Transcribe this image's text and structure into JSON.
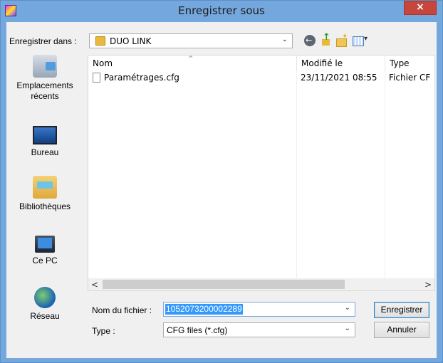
{
  "window": {
    "title": "Enregistrer sous",
    "close_glyph": "×"
  },
  "location": {
    "label": "Enregistrer dans :",
    "value": "DUO LINK"
  },
  "places": [
    {
      "label": "Emplacements récents",
      "icon": "recent-places-icon"
    },
    {
      "label": "Bureau",
      "icon": "desktop-icon"
    },
    {
      "label": "Bibliothèques",
      "icon": "libraries-icon"
    },
    {
      "label": "Ce PC",
      "icon": "this-pc-icon"
    },
    {
      "label": "Réseau",
      "icon": "network-icon"
    }
  ],
  "columns": {
    "name": "Nom",
    "modified": "Modifié le",
    "type": "Type"
  },
  "files": [
    {
      "name": "Paramétrages.cfg",
      "modified": "23/11/2021 08:55",
      "type": "Fichier CF"
    }
  ],
  "filename": {
    "label": "Nom du fichier :",
    "value": "1052073200002289"
  },
  "filetype": {
    "label": "Type :",
    "value": "CFG files (*.cfg)"
  },
  "buttons": {
    "save": "Enregistrer",
    "cancel": "Annuler"
  },
  "glyphs": {
    "dropdown": "⌄",
    "scroll_left": "<",
    "scroll_right": ">",
    "sort_up": "^"
  },
  "colors": {
    "title_bar": "#73a7dd",
    "close_button": "#c7463b",
    "selection": "#3399ff"
  }
}
